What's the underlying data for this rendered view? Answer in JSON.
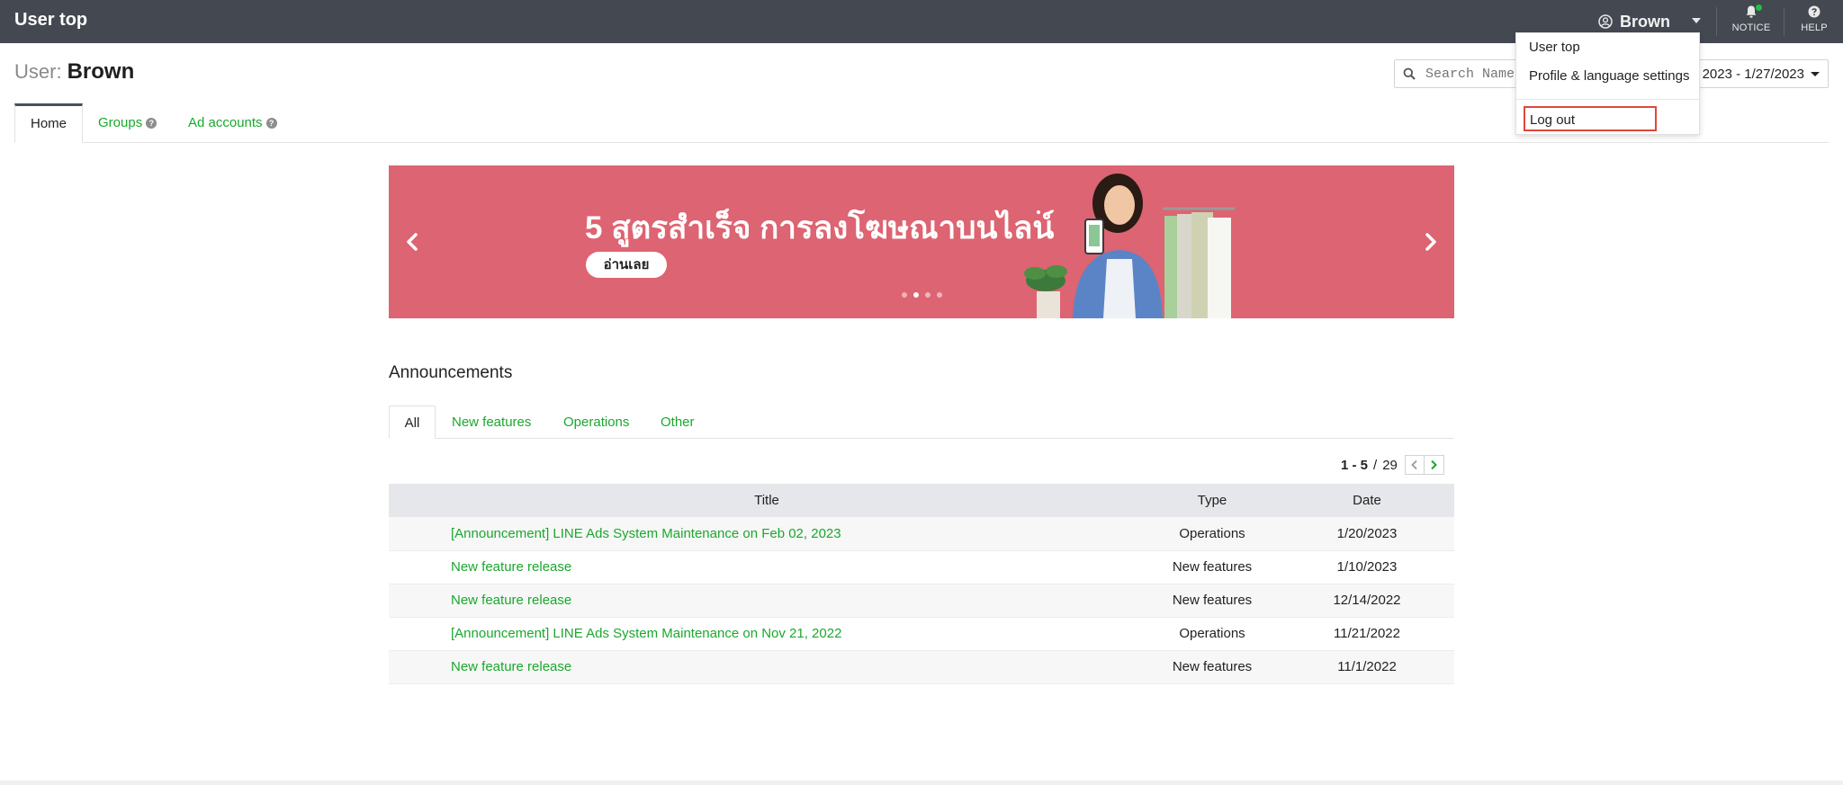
{
  "header": {
    "title": "User top",
    "user_name": "Brown",
    "notice_label": "NOTICE",
    "help_label": "HELP"
  },
  "user_menu": {
    "items": [
      "User top",
      "Profile & language settings"
    ],
    "logout": "Log out"
  },
  "page": {
    "user_prefix": "User:",
    "user_name": "Brown"
  },
  "search": {
    "placeholder": "Search Name"
  },
  "date_range": {
    "value": "2023 - 1/27/2023"
  },
  "tabs": [
    {
      "label": "Home",
      "active": true
    },
    {
      "label": "Groups",
      "help": true
    },
    {
      "label": "Ad accounts",
      "help": true
    }
  ],
  "banner": {
    "heading": "5 สูตรสำเร็จ การลงโฆษณาบนไลน์",
    "cta": "อ่านเลย",
    "slide_count": 4,
    "active_slide": 2,
    "background": "#dd6472"
  },
  "announcements": {
    "title": "Announcements",
    "tabs": [
      "All",
      "New features",
      "Operations",
      "Other"
    ],
    "active_tab": "All",
    "pager": {
      "range": "1 - 5",
      "separator": "/",
      "total": "29"
    },
    "columns": {
      "title": "Title",
      "type": "Type",
      "date": "Date"
    },
    "rows": [
      {
        "title": "[Announcement] LINE Ads System Maintenance on Feb 02, 2023",
        "type": "Operations",
        "date": "1/20/2023"
      },
      {
        "title": "New feature release",
        "type": "New features",
        "date": "1/10/2023"
      },
      {
        "title": "New feature release",
        "type": "New features",
        "date": "12/14/2022"
      },
      {
        "title": "[Announcement] LINE Ads System Maintenance on Nov 21, 2022",
        "type": "Operations",
        "date": "11/21/2022"
      },
      {
        "title": "New feature release",
        "type": "New features",
        "date": "11/1/2022"
      }
    ]
  },
  "colors": {
    "topbar": "#434851",
    "link_green": "#1aa82d",
    "highlight_red": "#e0463b"
  },
  "icons": [
    "user-circle-icon",
    "bell-icon",
    "help-circle-icon",
    "search-icon",
    "chevron-left-icon",
    "chevron-right-icon",
    "caret-down-icon"
  ]
}
